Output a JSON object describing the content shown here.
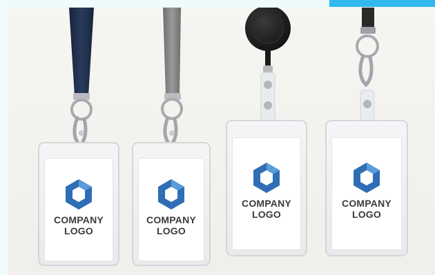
{
  "scene": {
    "description_free": true,
    "colors": {
      "background": "#f3f2ef",
      "navy_strap": "#1f2f4a",
      "gray_strap": "#8a8a8a",
      "reel": "#1c1c1c",
      "logo_blue": "#2f6db5",
      "logo_light": "#5a9bd8",
      "text": "#3b3b3b",
      "accent_bar": "#33b8f0"
    }
  },
  "badges": [
    {
      "line1": "COMPANY",
      "line2": "LOGO",
      "icon": "hexagon-logo-icon"
    },
    {
      "line1": "COMPANY",
      "line2": "LOGO",
      "icon": "hexagon-logo-icon"
    },
    {
      "line1": "COMPANY",
      "line2": "LOGO",
      "icon": "hexagon-logo-icon"
    },
    {
      "line1": "COMPANY",
      "line2": "LOGO",
      "icon": "hexagon-logo-icon"
    }
  ]
}
